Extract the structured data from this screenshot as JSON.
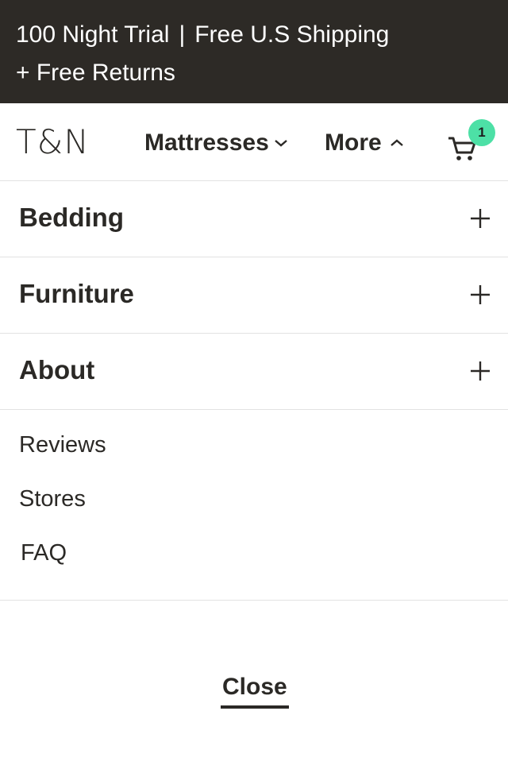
{
  "promo": {
    "line1_left": "100 Night Trial",
    "separator": "|",
    "line1_right": "Free U.S Shipping",
    "line2": "+ Free Returns"
  },
  "header": {
    "logo": "T&N",
    "nav": [
      {
        "label": "Mattresses",
        "icon": "chevron-down-icon"
      },
      {
        "label": "More",
        "icon": "chevron-up-icon"
      }
    ],
    "cart": {
      "icon": "cart-icon",
      "count": "1",
      "badge_color": "#4de0a6"
    }
  },
  "menu": {
    "sections": [
      {
        "label": "Bedding",
        "icon": "plus-icon"
      },
      {
        "label": "Furniture",
        "icon": "plus-icon"
      },
      {
        "label": "About",
        "icon": "plus-icon"
      }
    ],
    "links": [
      "Reviews",
      "Stores",
      "FAQ"
    ]
  },
  "close_label": "Close",
  "colors": {
    "promo_background": "#2d2a26",
    "text": "#2b2926",
    "divider": "#e2e2e2",
    "badge": "#4de0a6"
  }
}
